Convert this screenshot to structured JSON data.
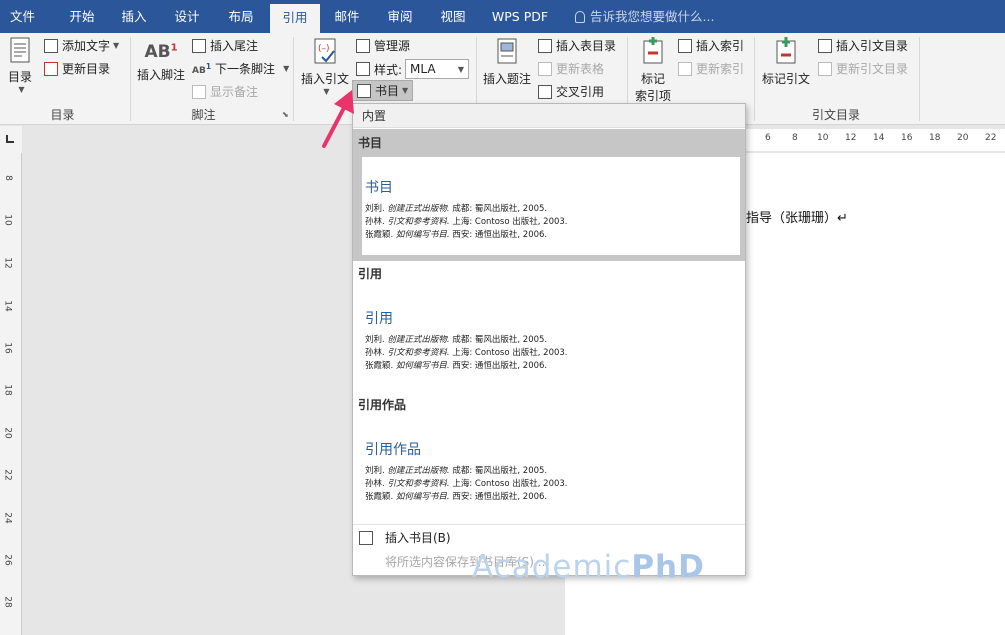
{
  "tabs": [
    {
      "label": "文件",
      "active": false
    },
    {
      "label": "开始",
      "active": false
    },
    {
      "label": "插入",
      "active": false
    },
    {
      "label": "设计",
      "active": false
    },
    {
      "label": "布局",
      "active": false
    },
    {
      "label": "引用",
      "active": true
    },
    {
      "label": "邮件",
      "active": false
    },
    {
      "label": "审阅",
      "active": false
    },
    {
      "label": "视图",
      "active": false
    },
    {
      "label": "WPS PDF",
      "active": false
    }
  ],
  "tell_me": "告诉我您想要做什么...",
  "ribbon": {
    "toc": {
      "group": "目录",
      "toc_button": "目录",
      "add_text": "添加文字",
      "update_toc": "更新目录"
    },
    "footnotes": {
      "group": "脚注",
      "insert_footnote": "插入脚注",
      "insert_endnote": "插入尾注",
      "next_footnote": "下一条脚注",
      "show_notes": "显示备注"
    },
    "citations": {
      "insert_citation": "插入引文",
      "manage_sources": "管理源",
      "style_label": "样式:",
      "style_value": "MLA",
      "bibliography": "书目"
    },
    "captions": {
      "insert_caption": "插入题注",
      "insert_table_figures": "插入表目录",
      "update_table": "更新表格",
      "cross_reference": "交叉引用"
    },
    "index": {
      "mark_entry_line1": "标记",
      "mark_entry_line2": "索引项",
      "insert_index": "插入索引",
      "update_index": "更新索引"
    },
    "toa": {
      "group": "引文目录",
      "mark_citation": "标记引文",
      "insert_toa": "插入引文目录",
      "update_toa": "更新引文目录"
    }
  },
  "ruler": {
    "top": [
      "6",
      "8",
      "10",
      "12",
      "14",
      "16",
      "18",
      "20",
      "22"
    ],
    "left": [
      "8",
      "10",
      "12",
      "14",
      "16",
      "18",
      "20",
      "22",
      "24",
      "26",
      "28"
    ]
  },
  "document": {
    "visible_text": "指导（张珊珊）↵"
  },
  "gallery": {
    "header": "内置",
    "sections": [
      {
        "title": "书目",
        "heading": "书目",
        "highlighted": true,
        "entries": [
          {
            "author": "刘利.",
            "title": "创建正式出版物.",
            "rest": "成都: 蜀风出版社, 2005."
          },
          {
            "author": "孙林.",
            "title": "引文和参考资料.",
            "rest": "上海: Contoso 出版社, 2003."
          },
          {
            "author": "张霞颖.",
            "title": "如何编写书目.",
            "rest": "西安: 通恒出版社, 2006."
          }
        ]
      },
      {
        "title": "引用",
        "heading": "引用",
        "highlighted": false,
        "entries": [
          {
            "author": "刘利.",
            "title": "创建正式出版物.",
            "rest": "成都: 蜀风出版社, 2005."
          },
          {
            "author": "孙林.",
            "title": "引文和参考资料.",
            "rest": "上海: Contoso 出版社, 2003."
          },
          {
            "author": "张霞颖.",
            "title": "如何编写书目.",
            "rest": "西安: 通恒出版社, 2006."
          }
        ]
      },
      {
        "title": "引用作品",
        "heading": "引用作品",
        "highlighted": false,
        "entries": [
          {
            "author": "刘利.",
            "title": "创建正式出版物.",
            "rest": "成都: 蜀风出版社, 2005."
          },
          {
            "author": "孙林.",
            "title": "引文和参考资料.",
            "rest": "上海: Contoso 出版社, 2003."
          },
          {
            "author": "张霞颖.",
            "title": "如何编写书目.",
            "rest": "西安: 通恒出版社, 2006."
          }
        ]
      }
    ],
    "insert_bibliography": "插入书目(B)",
    "save_selection": "将所选内容保存到书目库(S)..."
  },
  "watermark": {
    "part1": "Academic",
    "part2": "PhD"
  },
  "colors": {
    "tab_bar": "#2b579a",
    "accent_text": "#2e5e9a",
    "arrow": "#e8336b",
    "watermark": "#bcd3ec"
  }
}
